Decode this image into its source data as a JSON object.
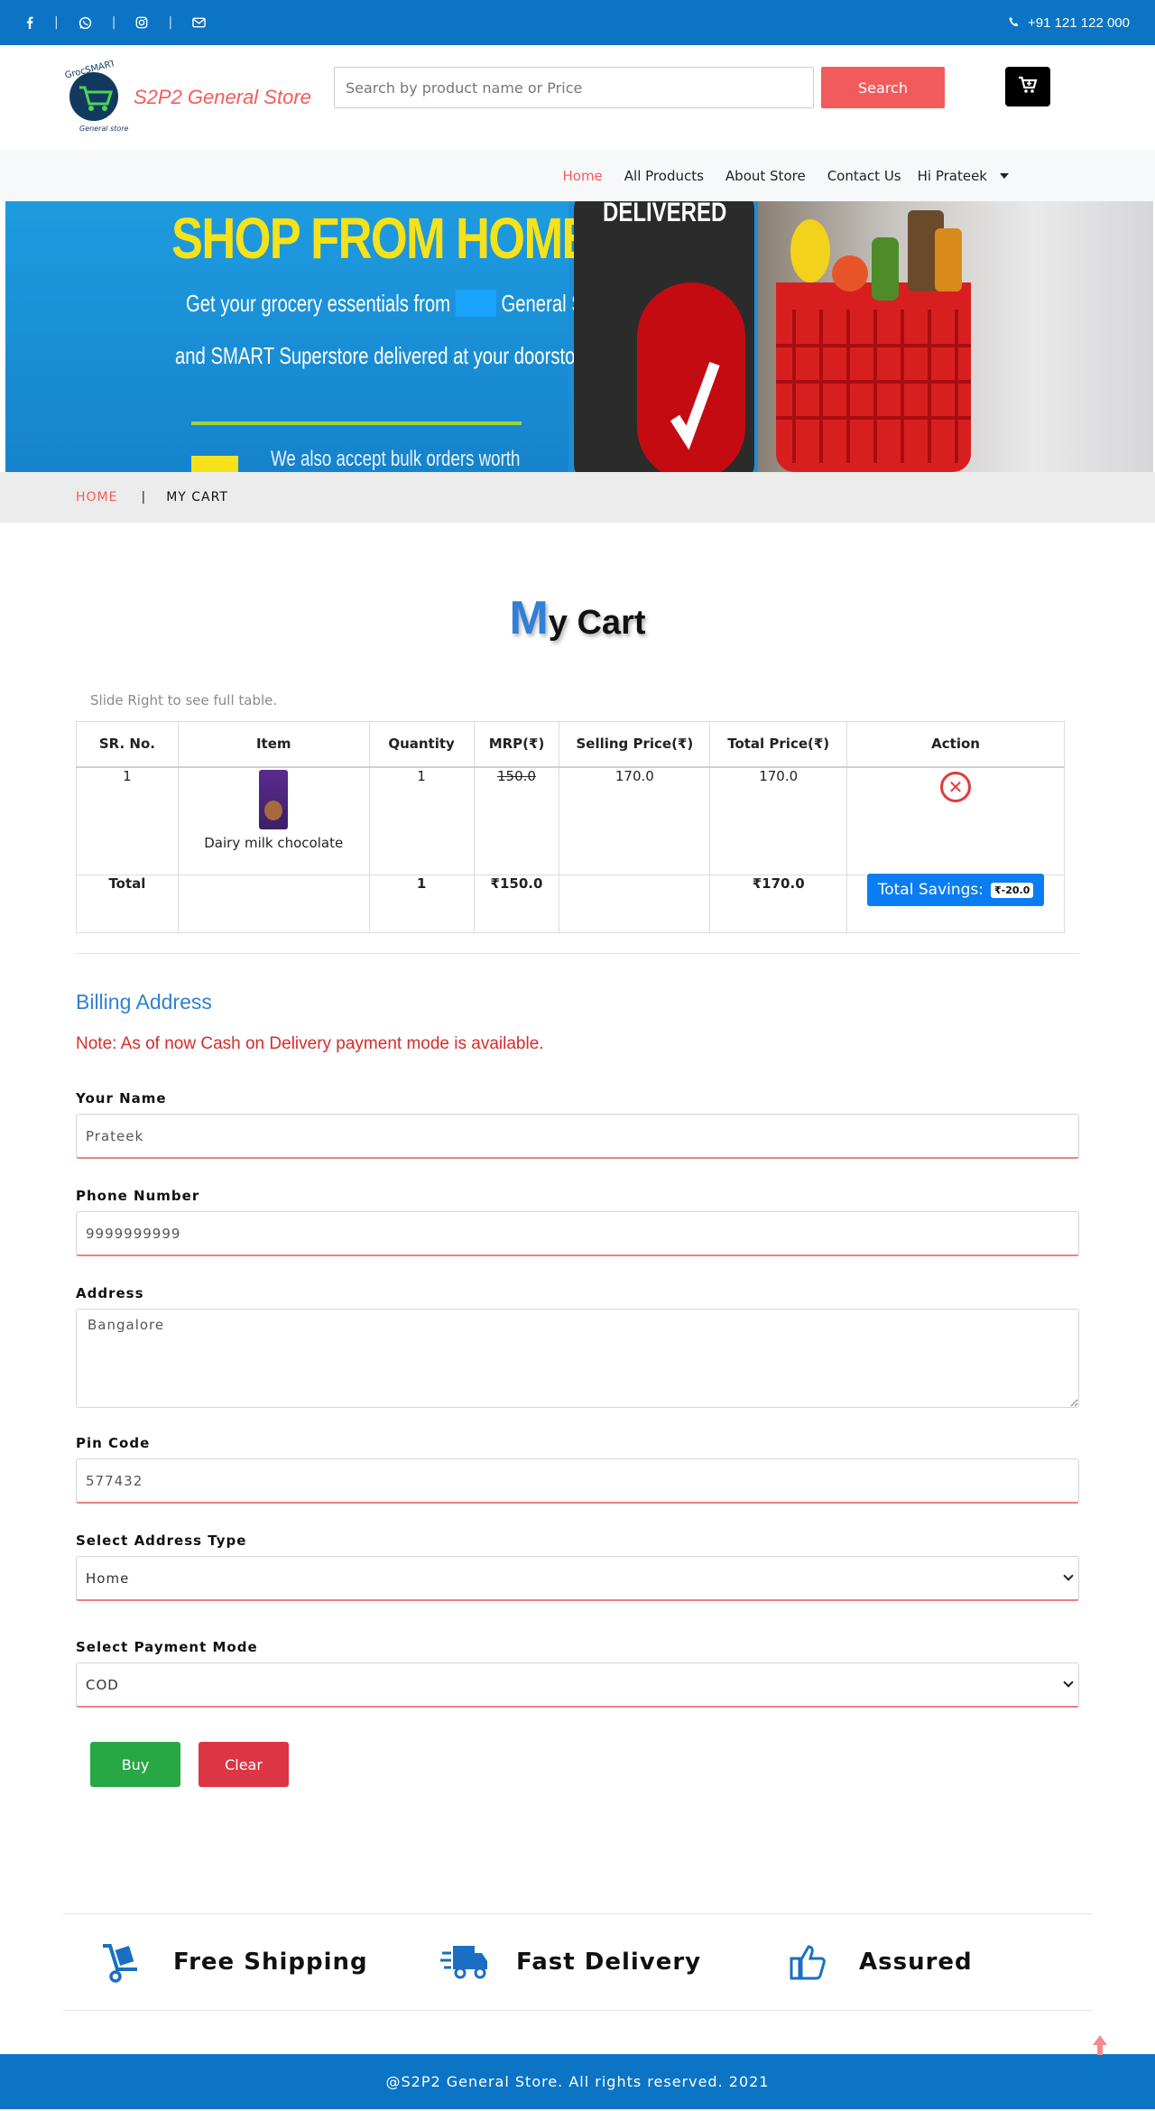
{
  "topbar": {
    "phone": "+91 121 122 000",
    "icons": [
      "facebook-icon",
      "whatsapp-icon",
      "instagram-icon",
      "mail-icon",
      "phone-icon"
    ]
  },
  "header": {
    "store_name": "S2P2 General Store",
    "logo_text_top": "GrocSMART",
    "logo_text_bottom": "General store",
    "search_placeholder": "Search by product name or Price",
    "search_button": "Search"
  },
  "nav": {
    "items": [
      "Home",
      "All Products",
      "About Store",
      "Contact Us"
    ],
    "user": "Hi Prateek"
  },
  "banner": {
    "headline": "SHOP FROM HOME.",
    "line1": "Get your grocery essentials from",
    "line1_tail": "General Stores",
    "line2": "and SMART Superstore delivered at your doorstop.",
    "line3": "We also accept bulk orders worth",
    "device_text": "DELIVERED"
  },
  "breadcrumb": {
    "home": "HOME",
    "divider": "|",
    "current": "MY CART"
  },
  "page": {
    "title_first": "M",
    "title_rest": "y Cart",
    "hint": "Slide Right to see full table."
  },
  "table": {
    "headers": [
      "SR. No.",
      "Item",
      "Quantity",
      "MRP(₹)",
      "Selling Price(₹)",
      "Total Price(₹)",
      "Action"
    ],
    "rows": [
      {
        "sr": "1",
        "item": "Dairy milk chocolate",
        "quantity": "1",
        "mrp": "150.0",
        "selling": "170.0",
        "total": "170.0"
      }
    ],
    "total_row": {
      "label": "Total",
      "quantity": "1",
      "mrp": "₹150.0",
      "total": "₹170.0",
      "savings_label": "Total Savings:",
      "savings_value": "₹-20.0"
    }
  },
  "billing": {
    "title": "Billing Address",
    "note": "Note: As of now Cash on Delivery payment mode is available.",
    "name_label": "Your Name",
    "name_value": "Prateek",
    "phone_label": "Phone Number",
    "phone_value": "9999999999",
    "address_label": "Address",
    "address_value": "Bangalore",
    "pin_label": "Pin Code",
    "pin_value": "577432",
    "address_type_label": "Select Address Type",
    "address_type_value": "Home",
    "payment_label": "Select Payment Mode",
    "payment_value": "COD",
    "buy": "Buy",
    "clear": "Clear"
  },
  "features": [
    {
      "icon": "hand-truck-icon",
      "label": "Free Shipping"
    },
    {
      "icon": "delivery-truck-icon",
      "label": "Fast Delivery"
    },
    {
      "icon": "thumbs-up-icon",
      "label": "Assured"
    }
  ],
  "footer": {
    "text": "@S2P2 General Store. All rights reserved. 2021"
  },
  "colors": {
    "brand_blue": "#0b74c4",
    "accent_red": "#f25b5b",
    "savings_blue": "#0b7df2",
    "buy_green": "#28a745",
    "clear_red": "#dc3545"
  }
}
